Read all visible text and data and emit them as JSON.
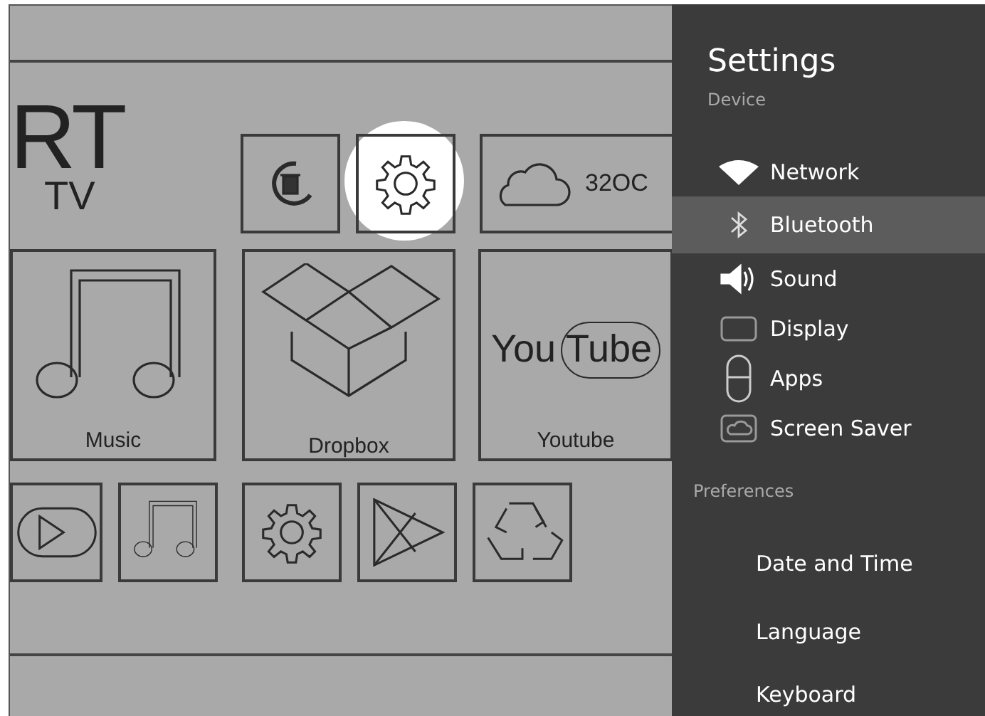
{
  "home": {
    "logo": {
      "title": "RT",
      "subtitle": "TV"
    },
    "shortcuts": [
      {
        "selected": false
      },
      {
        "selected": true
      },
      {
        "label": "32OC",
        "selected": false
      }
    ],
    "apps": [
      {
        "label": "Music"
      },
      {
        "label": "Dropbox"
      },
      {
        "logo_text": "You Tube",
        "label": "Youtube"
      }
    ]
  },
  "settings": {
    "title": "Settings",
    "sections": [
      {
        "heading": "Device",
        "items": [
          {
            "label": "Network",
            "selected": false
          },
          {
            "label": "Bluetooth",
            "selected": true
          },
          {
            "label": "Sound",
            "selected": false
          },
          {
            "label": "Display",
            "selected": false
          },
          {
            "label": "Apps",
            "selected": false
          },
          {
            "label": "Screen Saver",
            "selected": false
          }
        ]
      },
      {
        "heading": "Preferences",
        "items": [
          {
            "label": "Date and Time",
            "selected": false
          },
          {
            "label": "Language",
            "selected": false
          },
          {
            "label": "Keyboard",
            "selected": false
          }
        ]
      }
    ]
  }
}
